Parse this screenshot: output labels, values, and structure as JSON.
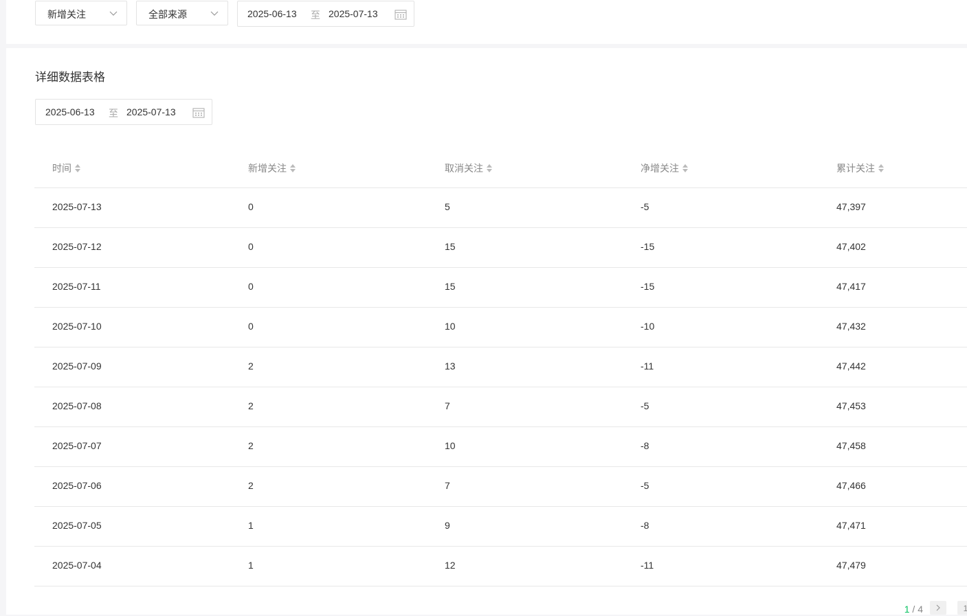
{
  "filters": {
    "metric_select": "新增关注",
    "source_select": "全部来源",
    "date_start": "2025-06-13",
    "date_sep": "至",
    "date_end": "2025-07-13"
  },
  "section": {
    "title": "详细数据表格",
    "date_start": "2025-06-13",
    "date_sep": "至",
    "date_end": "2025-07-13"
  },
  "table": {
    "headers": [
      "时间",
      "新增关注",
      "取消关注",
      "净增关注",
      "累计关注"
    ],
    "rows": [
      [
        "2025-07-13",
        "0",
        "5",
        "-5",
        "47,397"
      ],
      [
        "2025-07-12",
        "0",
        "15",
        "-15",
        "47,402"
      ],
      [
        "2025-07-11",
        "0",
        "15",
        "-15",
        "47,417"
      ],
      [
        "2025-07-10",
        "0",
        "10",
        "-10",
        "47,432"
      ],
      [
        "2025-07-09",
        "2",
        "13",
        "-11",
        "47,442"
      ],
      [
        "2025-07-08",
        "2",
        "7",
        "-5",
        "47,453"
      ],
      [
        "2025-07-07",
        "2",
        "10",
        "-8",
        "47,458"
      ],
      [
        "2025-07-06",
        "2",
        "7",
        "-5",
        "47,466"
      ],
      [
        "2025-07-05",
        "1",
        "9",
        "-8",
        "47,471"
      ],
      [
        "2025-07-04",
        "1",
        "12",
        "-11",
        "47,479"
      ]
    ]
  },
  "pagination": {
    "current": "1",
    "separator": "/",
    "total": "4",
    "jump_value": "1"
  },
  "icons": {
    "chevron": "chevron-down-icon",
    "calendar": "calendar-icon",
    "sort": "sort-icon",
    "next": "chevron-right-icon"
  },
  "colors": {
    "accent": "#07c160",
    "border": "#e3e3e3",
    "muted": "#888888"
  }
}
